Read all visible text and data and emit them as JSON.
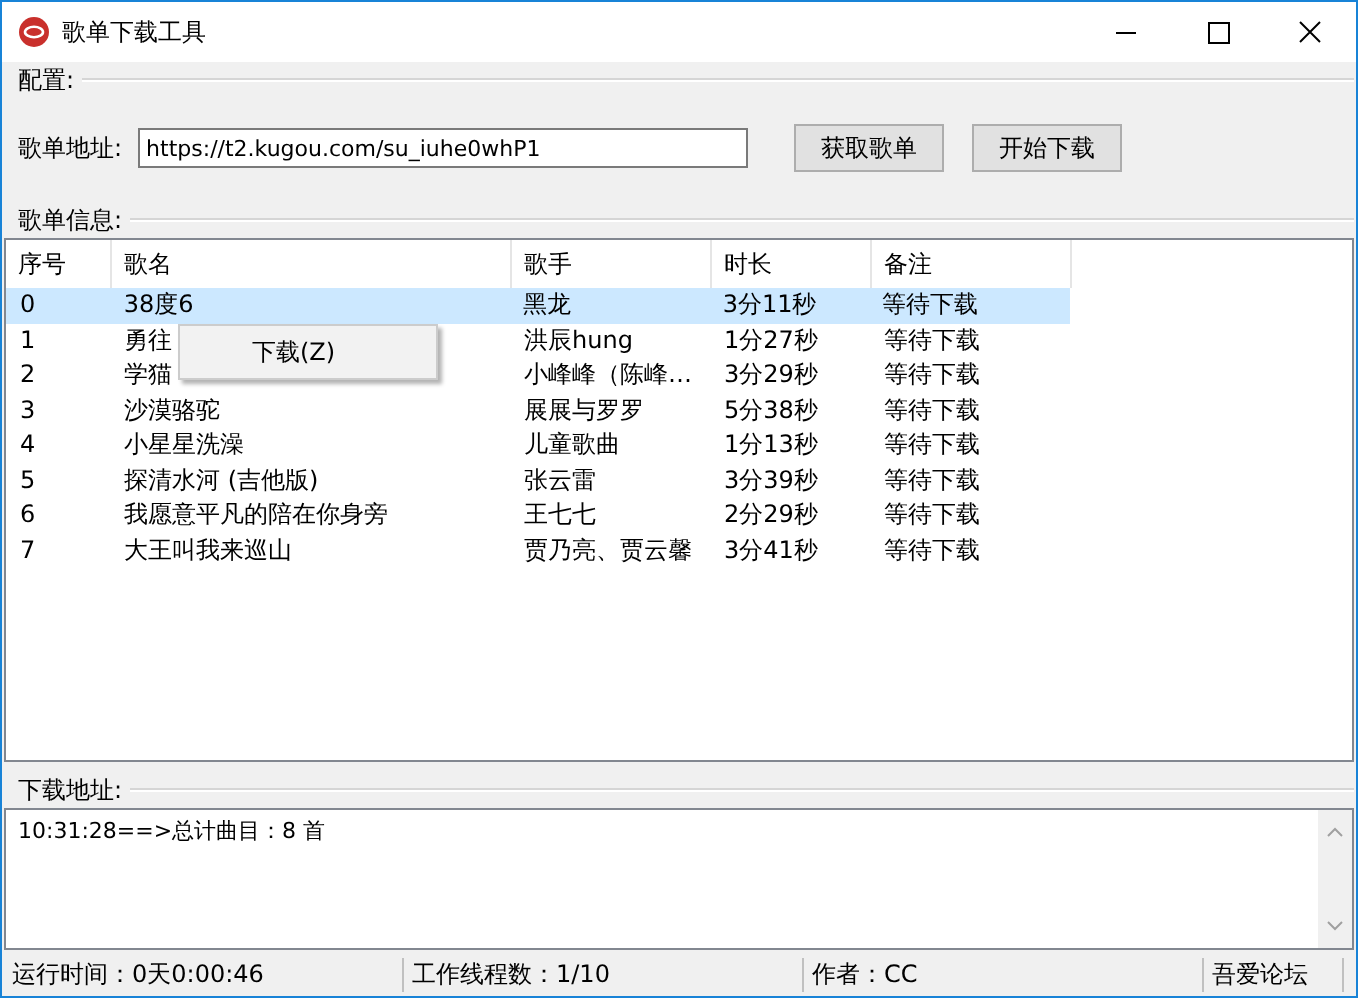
{
  "window": {
    "title": "歌单下载工具"
  },
  "config": {
    "label": "配置:",
    "url_label": "歌单地址:",
    "url_value": "https://t2.kugou.com/su_iuhe0whP1",
    "buttons": [
      "获取歌单",
      "开始下载"
    ]
  },
  "playlist": {
    "label": "歌单信息:",
    "columns": [
      "序号",
      "歌名",
      "歌手",
      "时长",
      "备注"
    ],
    "rows": [
      {
        "cells": [
          "0",
          "38度6",
          "黑龙",
          "3分11秒",
          "等待下载"
        ],
        "selected": true
      },
      {
        "cells": [
          "1",
          "勇往",
          "洪辰hung",
          "1分27秒",
          "等待下载"
        ],
        "selected": false
      },
      {
        "cells": [
          "2",
          "学猫",
          "小峰峰（陈峰…",
          "3分29秒",
          "等待下载"
        ],
        "selected": false
      },
      {
        "cells": [
          "3",
          "沙漠骆驼",
          "展展与罗罗",
          "5分38秒",
          "等待下载"
        ],
        "selected": false
      },
      {
        "cells": [
          "4",
          "小星星洗澡",
          "儿童歌曲",
          "1分13秒",
          "等待下载"
        ],
        "selected": false
      },
      {
        "cells": [
          "5",
          "探清水河 (吉他版)",
          "张云雷",
          "3分39秒",
          "等待下载"
        ],
        "selected": false
      },
      {
        "cells": [
          "6",
          "我愿意平凡的陪在你身旁",
          "王七七",
          "2分29秒",
          "等待下载"
        ],
        "selected": false
      },
      {
        "cells": [
          "7",
          "大王叫我来巡山",
          "贾乃亮、贾云馨",
          "3分41秒",
          "等待下载"
        ],
        "selected": false
      }
    ]
  },
  "context_menu": {
    "items": [
      "下载(Z)"
    ]
  },
  "download": {
    "label": "下载地址:",
    "log": "10:31:28==>总计曲目：8 首"
  },
  "status_bar": [
    "运行时间：0天0:00:46",
    "工作线程数：1/10",
    "作者：CC",
    "吾爱论坛"
  ]
}
